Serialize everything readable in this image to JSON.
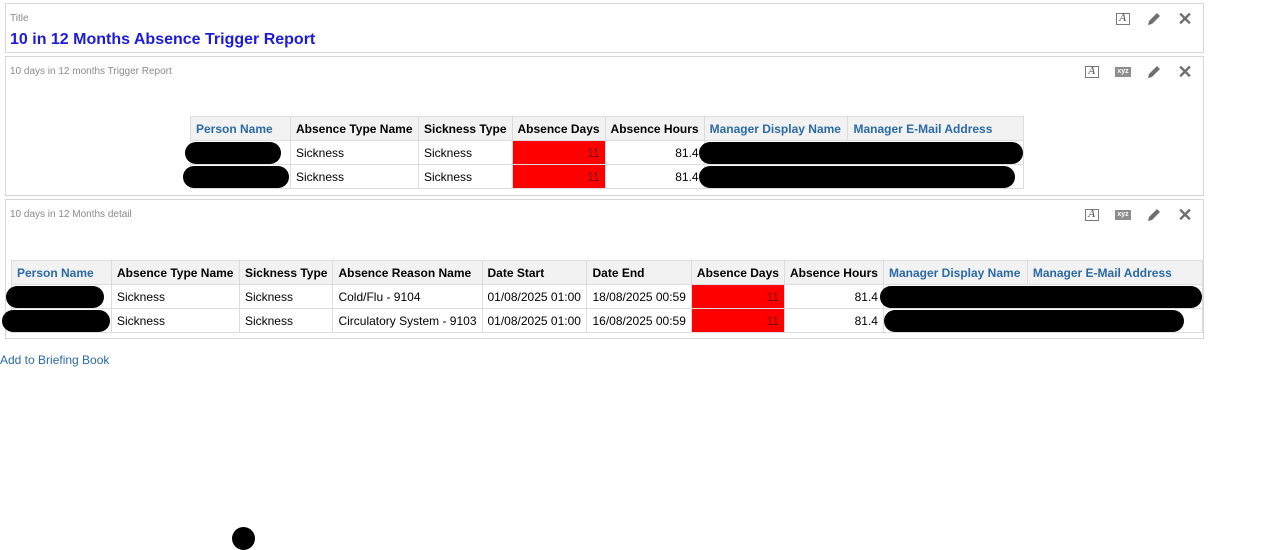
{
  "title_panel": {
    "caption": "Title",
    "title": "10 in 12 Months Absence Trigger Report"
  },
  "summary_panel": {
    "caption": "10 days in 12 months Trigger Report",
    "columns": [
      "Person Name",
      "Absence Type Name",
      "Sickness Type",
      "Absence Days",
      "Absence Hours",
      "Manager Display Name",
      "Manager E-Mail Address"
    ],
    "rows": [
      {
        "person": "",
        "absence_type": "Sickness",
        "sickness_type": "Sickness",
        "absence_days": "11",
        "absence_hours": "81.4",
        "manager_name": "",
        "manager_email": ""
      },
      {
        "person": "",
        "absence_type": "Sickness",
        "sickness_type": "Sickness",
        "absence_days": "11",
        "absence_hours": "81.4",
        "manager_name": "",
        "manager_email": ""
      }
    ]
  },
  "detail_panel": {
    "caption": "10 days in 12 Months detail",
    "columns": [
      "Person Name",
      "Absence Type Name",
      "Sickness Type",
      "Absence Reason Name",
      "Date Start",
      "Date End",
      "Absence Days",
      "Absence Hours",
      "Manager Display Name",
      "Manager E-Mail Address"
    ],
    "rows": [
      {
        "person": "",
        "absence_type": "Sickness",
        "sickness_type": "Sickness",
        "reason": "Cold/Flu - 9104",
        "date_start": "01/08/2025 01:00",
        "date_end": "18/08/2025 00:59",
        "absence_days": "11",
        "absence_hours": "81.4",
        "manager_name": "",
        "manager_email": ""
      },
      {
        "person": "",
        "absence_type": "Sickness",
        "sickness_type": "Sickness",
        "reason": "Circulatory System - 9103",
        "date_start": "01/08/2025 01:00",
        "date_end": "16/08/2025 00:59",
        "absence_days": "11",
        "absence_hours": "81.4",
        "manager_name": "",
        "manager_email": ""
      }
    ]
  },
  "footer": {
    "briefing_link": "Add to Briefing Book"
  },
  "icons": {
    "format": "format-text-icon",
    "xyz": "xyz-icon",
    "edit": "pencil-icon",
    "close": "close-icon",
    "xyz_label": "xyz",
    "format_label": "A"
  },
  "colors": {
    "title": "#1c1cd8",
    "link": "#2a6aa5",
    "highlight": "#ff0000"
  }
}
